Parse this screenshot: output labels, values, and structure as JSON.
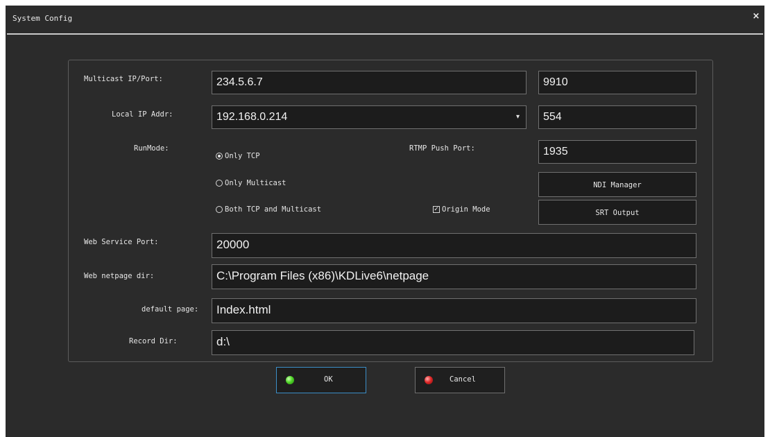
{
  "window": {
    "title": "System Config",
    "close_glyph": "×"
  },
  "form": {
    "multicast": {
      "label": "Multicast IP/Port:",
      "ip": "234.5.6.7",
      "port": "9910"
    },
    "local_ip": {
      "label": "Local IP Addr:",
      "value": "192.168.0.214",
      "arrow": "▾",
      "port": "554"
    },
    "run_mode": {
      "label": "RunMode:",
      "options": [
        {
          "label": "Only TCP",
          "selected": true
        },
        {
          "label": "Only Multicast",
          "selected": false
        },
        {
          "label": "Both TCP and Multicast",
          "selected": false
        }
      ]
    },
    "rtmp": {
      "label": "RTMP Push Port:",
      "value": "1935"
    },
    "ndi_button": "NDI Manager",
    "srt_button": "SRT Output",
    "origin_mode": {
      "label": "Origin Mode",
      "checked": true,
      "check_glyph": "✓"
    },
    "web_service_port": {
      "label": "Web Service Port:",
      "value": "20000"
    },
    "web_netpage_dir": {
      "label": "Web netpage dir:",
      "value": "C:\\Program Files (x86)\\KDLive6\\netpage"
    },
    "default_page": {
      "label": "default page:",
      "value": "Index.html"
    },
    "record_dir": {
      "label": "Record Dir:",
      "value": "d:\\"
    }
  },
  "buttons": {
    "ok": {
      "label": "OK",
      "led_color": "#3ecf1a"
    },
    "cancel": {
      "label": "Cancel",
      "led_color": "#e02a2a"
    }
  },
  "colors": {
    "background": "#2b2b2b",
    "field_bg": "#1c1c1c",
    "focus_border": "#3c8fc8"
  }
}
